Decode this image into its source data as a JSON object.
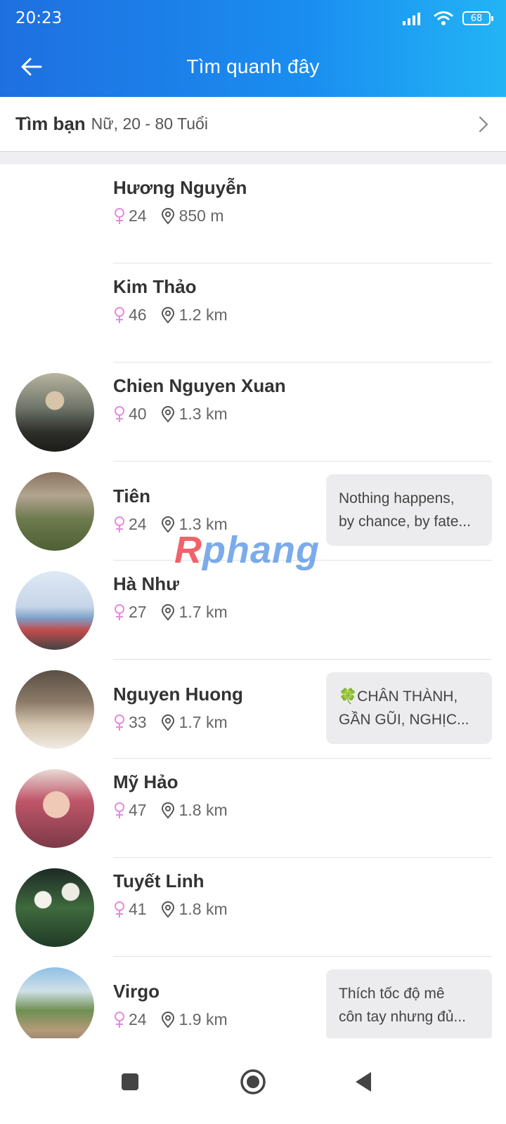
{
  "status_bar": {
    "time": "20:23",
    "battery": "68"
  },
  "header": {
    "title": "Tìm quanh đây"
  },
  "filter": {
    "label": "Tìm bạn",
    "subtitle": "Nữ, 20 - 80 Tuổi"
  },
  "watermark": {
    "first": "R",
    "rest": "phang"
  },
  "people": [
    {
      "name": "Hương Nguyễn",
      "age": "24",
      "distance": "850 m",
      "has_avatar": false,
      "status": []
    },
    {
      "name": "Kim Thảo",
      "age": "46",
      "distance": "1.2 km",
      "has_avatar": false,
      "status": []
    },
    {
      "name": "Chien Nguyen Xuan",
      "age": "40",
      "distance": "1.3 km",
      "has_avatar": true,
      "status": []
    },
    {
      "name": "Tiên",
      "age": "24",
      "distance": "1.3 km",
      "has_avatar": true,
      "status": [
        "Nothing happens,",
        "by chance, by fate..."
      ]
    },
    {
      "name": "Hà Như",
      "age": "27",
      "distance": "1.7 km",
      "has_avatar": true,
      "status": []
    },
    {
      "name": "Nguyen Huong",
      "age": "33",
      "distance": "1.7 km",
      "has_avatar": true,
      "status": [
        "🍀CHÂN THÀNH,",
        "GẦN GŨI, NGHỊC..."
      ]
    },
    {
      "name": "Mỹ Hảo",
      "age": "47",
      "distance": "1.8 km",
      "has_avatar": true,
      "status": []
    },
    {
      "name": "Tuyết Linh",
      "age": "41",
      "distance": "1.8 km",
      "has_avatar": true,
      "status": []
    },
    {
      "name": "Virgo",
      "age": "24",
      "distance": "1.9 km",
      "has_avatar": true,
      "status": [
        "Thích tốc độ mê",
        "côn tay nhưng đủ..."
      ]
    }
  ],
  "colors": {
    "header_start": "#1f6fe0",
    "header_end": "#22b4f5",
    "female_icon": "#e58ae0",
    "bubble_bg": "#ececee"
  },
  "icons": {
    "back": "back-arrow-icon",
    "chevron": "chevron-right-icon",
    "gender": "female-icon",
    "location": "location-pin-icon",
    "nav": [
      "recents-square-icon",
      "home-circle-icon",
      "back-triangle-icon"
    ]
  }
}
